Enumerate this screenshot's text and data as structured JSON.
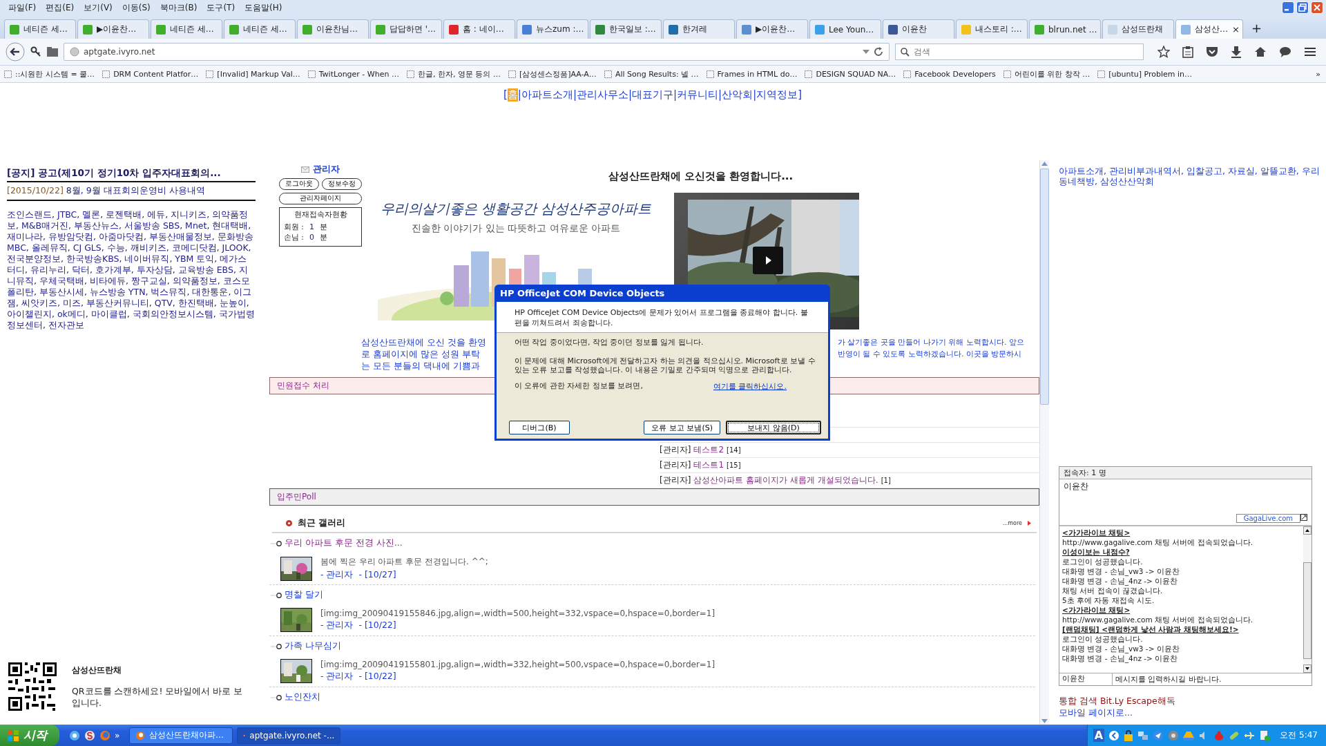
{
  "menu": [
    "파일(F)",
    "편집(E)",
    "보기(V)",
    "이동(S)",
    "북마크(B)",
    "도구(T)",
    "도움말(H)"
  ],
  "tabs": [
    {
      "label": "네티즌 세…",
      "color": "#3fae2a",
      "selected": false
    },
    {
      "label": "▶이윤찬…",
      "color": "#3fae2a",
      "selected": false
    },
    {
      "label": "네티즌 세…",
      "color": "#3fae2a",
      "selected": false
    },
    {
      "label": "네티즌 세…",
      "color": "#3fae2a",
      "selected": false
    },
    {
      "label": "이윤찬님…",
      "color": "#3fae2a",
      "selected": false
    },
    {
      "label": "답답하면 '…",
      "color": "#3fae2a",
      "selected": false
    },
    {
      "label": "홈 : 네이…",
      "color": "#e0262b",
      "selected": false
    },
    {
      "label": "뉴스zum :…",
      "color": "#4a7fd8",
      "selected": false
    },
    {
      "label": "한국일보 :…",
      "color": "#2f8a3c",
      "selected": false
    },
    {
      "label": "한겨레",
      "color": "#1e6fa8",
      "selected": false
    },
    {
      "label": "▶이윤찬…",
      "color": "#5b8fd0",
      "selected": false
    },
    {
      "label": "Lee Youn…",
      "color": "#3aa1e8",
      "selected": false
    },
    {
      "label": "이윤찬",
      "color": "#3b5998",
      "selected": false
    },
    {
      "label": "내스토리 :…",
      "color": "#f2c21b",
      "selected": false
    },
    {
      "label": "blrun.net …",
      "color": "#3fae2a",
      "selected": false
    },
    {
      "label": "삼성뜨란채",
      "color": "#c8d6ea",
      "selected": false
    },
    {
      "label": "삼성산…",
      "color": "#8fb8e8",
      "selected": true
    }
  ],
  "tab_close": "×",
  "new_tab": "+",
  "address": {
    "url": "aptgate.ivyro.net"
  },
  "search": {
    "placeholder": "검색"
  },
  "bookmarks": [
    "::시원한 시스템 = 쿨…",
    "DRM Content Platfor…",
    "[Invalid] Markup Val…",
    "TwitLonger - When …",
    "한글, 한자, 영문 등의 …",
    "[삼성센스정품]AA-A…",
    "All Song Results: 넬 …",
    "Frames in HTML do…",
    "DESIGN SQUAD NA…",
    "Facebook Developers",
    "어린이를 위한 창작 …",
    "[ubuntu] Problem in…"
  ],
  "bookmarks_more": "»",
  "site_nav": {
    "open": "[",
    "close": "]",
    "separator": "|",
    "items": [
      {
        "label": "홈",
        "selected": true
      },
      {
        "label": "아파트소개",
        "selected": false
      },
      {
        "label": "관리사무소",
        "selected": false
      },
      {
        "label": "대표기구",
        "selected": false
      },
      {
        "label": "커뮤니티",
        "selected": false
      },
      {
        "label": "산악회",
        "selected": false
      },
      {
        "label": "지역정보",
        "selected": false
      }
    ]
  },
  "notice": {
    "title": "[공지] 공고(제10기 정기10차 입주자대표회의...",
    "date": "[2015/10/22]",
    "latest": "8월, 9월 대표회의운영비 사용내역"
  },
  "partner_links": "조인스랜드, JTBC, 멜론, 로젠택배, 에듀, 지니키즈, 의약품정보, M&B매거진, 부동산뉴스, 서울방송 SBS, Mnet, 현대택배, 재미나라, 유방암닷컴, 아줌마닷컴, 부동산매물정보, 문화방송 MBC, 올레뮤직, CJ GLS, 수능, 깨비키즈, 코메디닷컴, JLOOK, 전국분양정보, 한국방송KBS, 네이버뮤직, YBM 토익, 메가스터디, 유리누리, 닥터, 호가계부, 투자상담, 교육방송 EBS, 지니뮤직, 우체국택배, 비타에듀, 짱구교실, 의약품정보, 코스모폴리탄, 부동산시세, 뉴스방송 YTN, 벅스뮤직, 대한통운, 이그잼, 씨앗키즈, 미즈, 부동산커뮤니티, QTV, 한진택배, 눈높이, 아이챌린지, ok메디, 마이클럽, 국회의안정보시스템, 국가법령정보센터, 전자관보",
  "qr": {
    "site": "삼성산뜨란채",
    "caption": "QR코드를 스캔하세요! 모바일에서 바로 보입니다."
  },
  "login": {
    "user": "관리자",
    "buttons": [
      "로그아웃",
      "정보수정"
    ],
    "admin_button": "관리자페이지",
    "status_title": "현재접속자현황",
    "stats": [
      {
        "label": "회원 :",
        "value": "1",
        "unit": "분"
      },
      {
        "label": "손님 :",
        "value": "0",
        "unit": "분"
      }
    ]
  },
  "welcome": "삼성산뜨란채에 오신것을 환영합니다...",
  "banner": {
    "slogan": "우리의살기좋은 생활공간 삼성산주공아파트",
    "subtitle": "진솔한 이야기가 있는 따뜻하고 여유로운 아파트"
  },
  "intro_left": [
    "삼성산뜨란채에 오신 것을 환영",
    "로 홈페이지에 많은 성원 부탁",
    "는 모든 분들의 댁내에 기쁨과"
  ],
  "intro_right": [
    "가 살기좋은 곳을 만들어 나가기 위해 노력합시다. 앞으",
    "반영이 될 수 있도록 노력하겠습니다. 이곳을 방문하시"
  ],
  "complaints": {
    "title": "민원접수 처리",
    "posts": [
      {
        "author": "[관리자]",
        "title": "테스트2",
        "count": "[14]"
      },
      {
        "author": "[관리자]",
        "title": "테스트1",
        "count": "[15]"
      },
      {
        "author": "[관리자]",
        "title": "삼성산아파트 홈페이지가 새롭게 개설되었습니다.",
        "count": "[1]"
      }
    ]
  },
  "poll": {
    "title": "입주민Poll"
  },
  "gallery": {
    "title": "최근 갤러리",
    "more": "...more",
    "items": [
      {
        "title": "우리 아파트 후문 전경 사진...",
        "visited": true,
        "body": "봄에 찍은 우리 아파트 후문 전경입니다. ^^;",
        "author": "- 관리자",
        "date": "- [10/27]"
      },
      {
        "title": "명찰 달기",
        "visited": false,
        "body": "[img:img_20090419155846.jpg,align=,width=500,height=332,vspace=0,hspace=0,border=1]",
        "author": "- 관리자",
        "date": "- [10/22]"
      },
      {
        "title": "가족 나무심기",
        "visited": false,
        "body": "[img:img_20090419155801.jpg,align=,width=332,height=500,vspace=0,hspace=0,border=1]",
        "author": "- 관리자",
        "date": "- [10/22]"
      },
      {
        "title": "노인잔치",
        "visited": false
      }
    ]
  },
  "right_links": "아파트소개, 관리비부과내역서, 입찰공고, 자료실, 알뜰교환, 우리동네책방, 삼성산산악회",
  "chat": {
    "users_label": "접속자: 1 명",
    "users": [
      "이윤찬"
    ],
    "brand": "GagaLive.com",
    "messages": [
      {
        "kind": "heading",
        "text": "<가가라이브 채팅>"
      },
      {
        "kind": "line",
        "text": "http://www.gagalive.com 채팅 서버에 접속되었습니다."
      },
      {
        "kind": "heading",
        "text": "이성이보는 내점수?"
      },
      {
        "kind": "line",
        "text": "로그인이 성공했습니다."
      },
      {
        "kind": "line",
        "text": "대화명 변경 - 손님_vw3 -> 이윤찬"
      },
      {
        "kind": "line",
        "text": "대화명 변경 - 손님_4nz -> 이윤찬"
      },
      {
        "kind": "line",
        "text": "채팅 서버 접속이 끊겼습니다."
      },
      {
        "kind": "line",
        "text": "5초 후에 자동 재접속 시도."
      },
      {
        "kind": "heading",
        "text": "<가가라이브 채팅>"
      },
      {
        "kind": "line",
        "text": "http://www.gagalive.com 채팅 서버에 접속되었습니다."
      },
      {
        "kind": "heading",
        "text": "[랜덤채팅] <랜덤하게 낯선 사람과 채팅해보세요!>"
      },
      {
        "kind": "line",
        "text": "로그인이 성공했습니다."
      },
      {
        "kind": "line",
        "text": "대화명 변경 - 손님_vw3 -> 이윤찬"
      },
      {
        "kind": "line",
        "text": "대화명 변경 - 손님_4nz -> 이윤찬"
      }
    ],
    "nick": "이윤찬",
    "placeholder": "메시지를 입력하시길 바랍니다."
  },
  "search_link": "통합 검색 Bit.Ly Escape해독",
  "mobile_link": "모바일 페이지로...",
  "dialog": {
    "title": "HP OfficeJet COM Device Objects",
    "message": "HP OfficeJet COM Device Objects에 문제가 있어서 프로그램을 종료해야 합니다. 불편을 끼쳐드려서 죄송합니다.",
    "warning": "어떤 작업 중이었다면, 작업 중이던 정보를 잃게 됩니다.",
    "report": "이 문제에 대해 Microsoft에게 전달하고자 하는 의견을 적으십시오. Microsoft로 보낼 수 있는 오류 보고를 작성했습니다. 이 내용은 기밀로 간주되며 익명으로 관리합니다.",
    "details": "이 오류에 관한 자세한 정보를 보려면,",
    "details_link": "여기를 클릭하십시오.",
    "buttons": [
      {
        "label": "디버그(B)",
        "default": false
      },
      {
        "label": "오류 보고 보냄(S)",
        "default": false
      },
      {
        "label": "보내지 않음(D)",
        "default": true
      }
    ]
  },
  "taskbar": {
    "start": "시작",
    "more": "»",
    "tasks": [
      {
        "label": "삼성산뜨란채아파...",
        "selected": false
      },
      {
        "label": "aptgate.ivyro.net -...",
        "selected": true
      }
    ],
    "ime": "A",
    "clock": "오전 5:47"
  }
}
